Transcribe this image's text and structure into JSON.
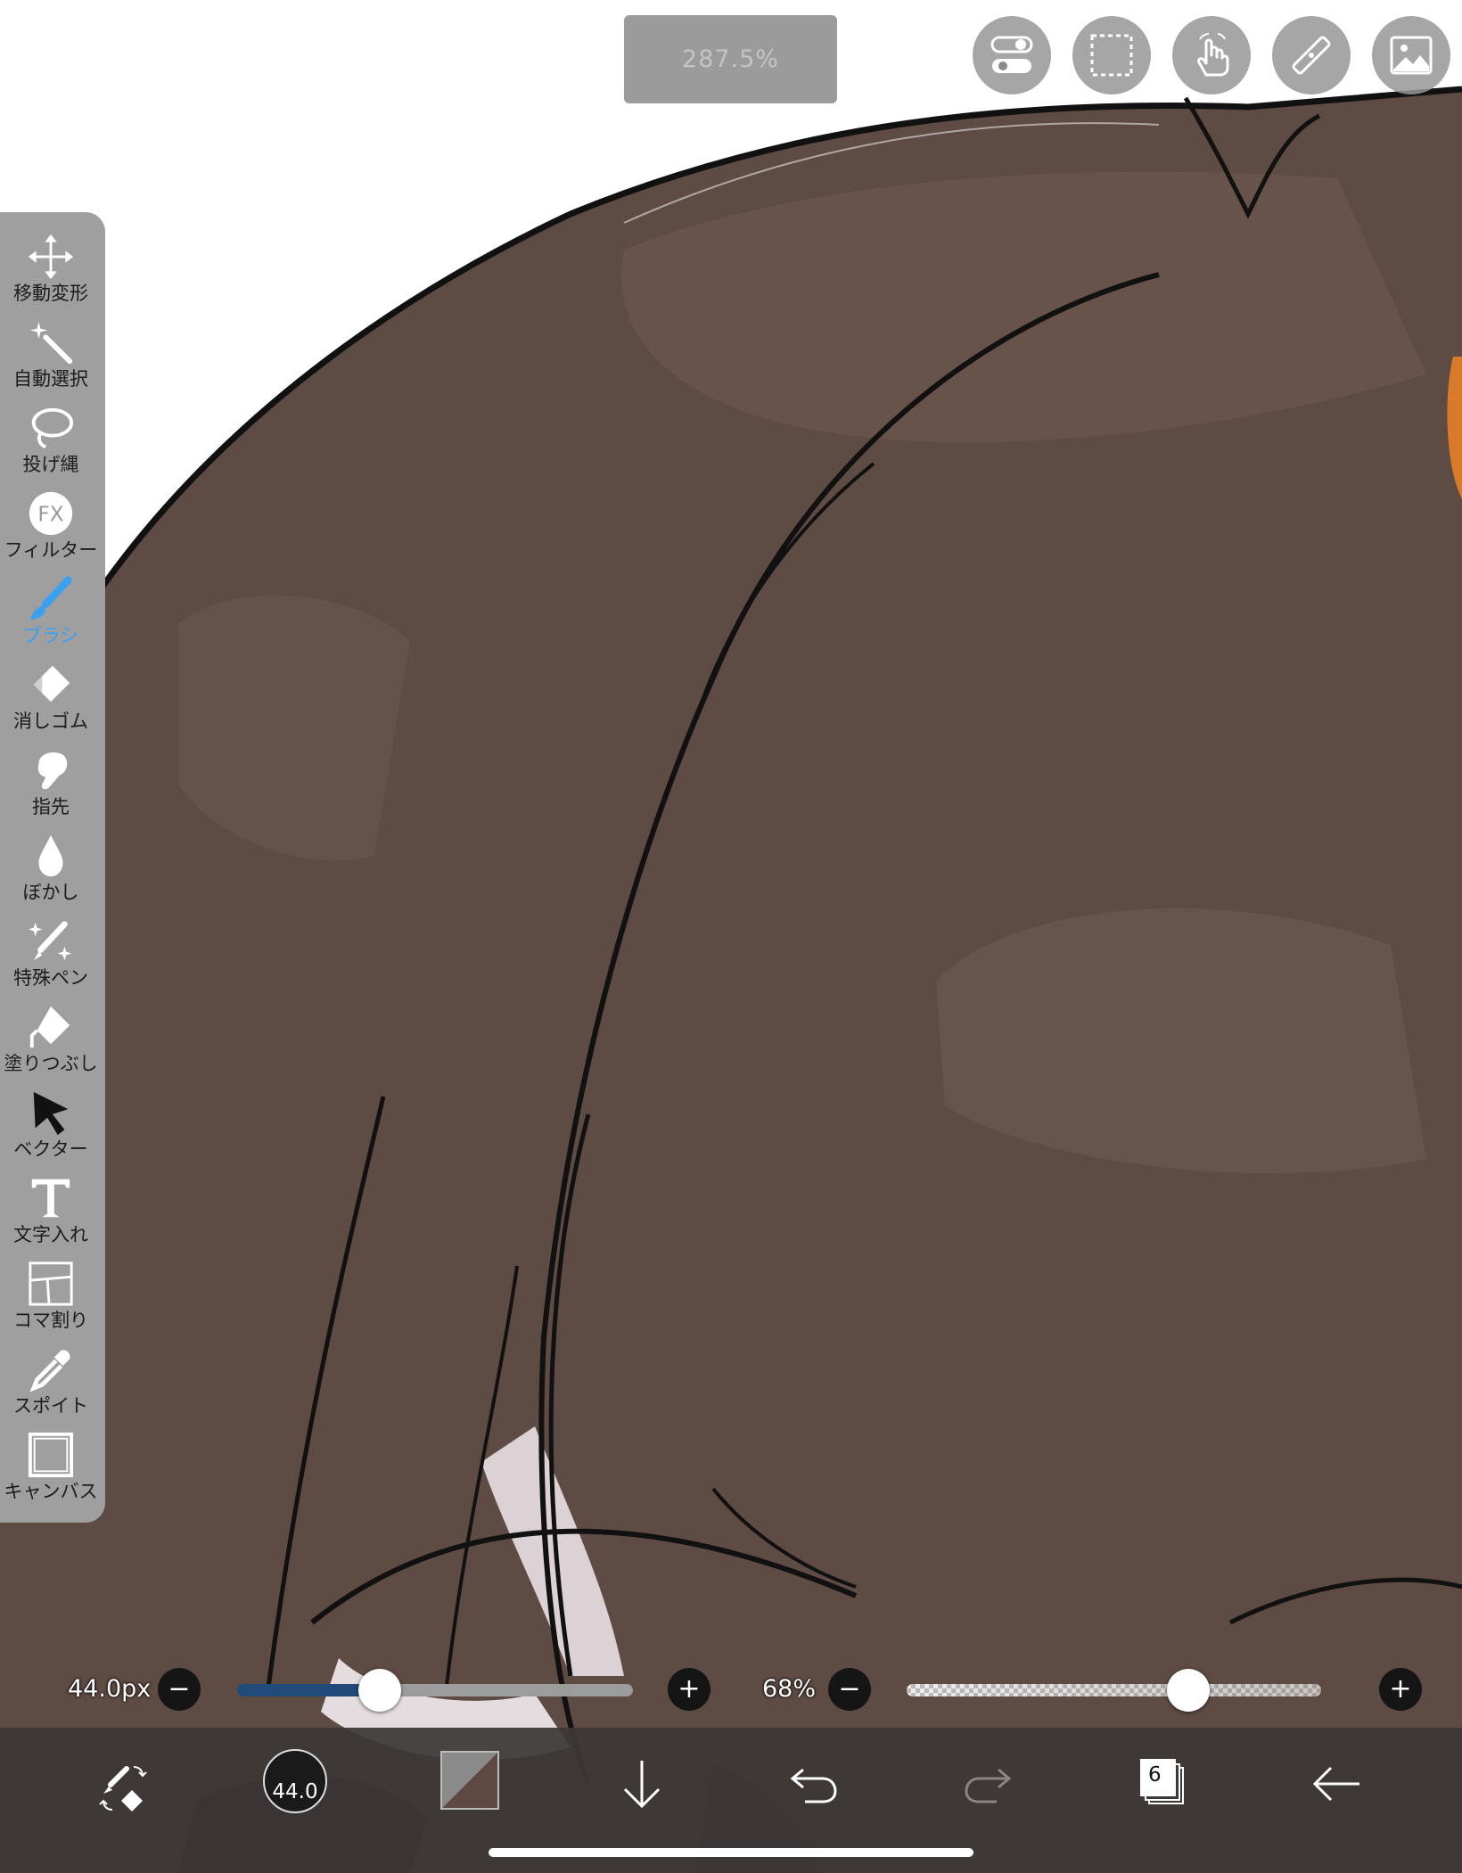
{
  "zoom": {
    "label": "287.5%"
  },
  "top_buttons": [
    {
      "name": "toggle-settings",
      "icon": "toggle-icon"
    },
    {
      "name": "selection",
      "icon": "selection-rect-icon"
    },
    {
      "name": "gesture",
      "icon": "hand-tap-icon"
    },
    {
      "name": "ruler",
      "icon": "ruler-icon"
    },
    {
      "name": "material",
      "icon": "image-icon"
    }
  ],
  "toolbar": {
    "tools": [
      {
        "label": "移動変形",
        "icon": "move-icon"
      },
      {
        "label": "自動選択",
        "icon": "magic-wand-icon"
      },
      {
        "label": "投げ縄",
        "icon": "lasso-icon"
      },
      {
        "label": "フィルター",
        "icon": "fx-icon"
      },
      {
        "label": "ブラシ",
        "icon": "brush-icon",
        "active": true
      },
      {
        "label": "消しゴム",
        "icon": "eraser-icon"
      },
      {
        "label": "指先",
        "icon": "smudge-icon"
      },
      {
        "label": "ぼかし",
        "icon": "blur-drop-icon"
      },
      {
        "label": "特殊ペン",
        "icon": "special-pen-icon"
      },
      {
        "label": "塗りつぶし",
        "icon": "fill-icon"
      },
      {
        "label": "ベクター",
        "icon": "vector-arrow-icon"
      },
      {
        "label": "文字入れ",
        "icon": "text-icon"
      },
      {
        "label": "コマ割り",
        "icon": "frame-divide-icon"
      },
      {
        "label": "スポイト",
        "icon": "eyedropper-icon"
      },
      {
        "label": "キャンバス",
        "icon": "canvas-icon"
      }
    ]
  },
  "brush_size": {
    "label": "44.0px",
    "value_fraction": 0.36
  },
  "opacity": {
    "label": "68%",
    "value_fraction": 0.68
  },
  "bottom_bar": {
    "brush_size_badge": "44.0",
    "layer_count": "6",
    "current_color": "#5e4a42"
  },
  "colors": {
    "accent": "#3aa0ef",
    "hair": "#5e4b43",
    "line": "#111111"
  }
}
